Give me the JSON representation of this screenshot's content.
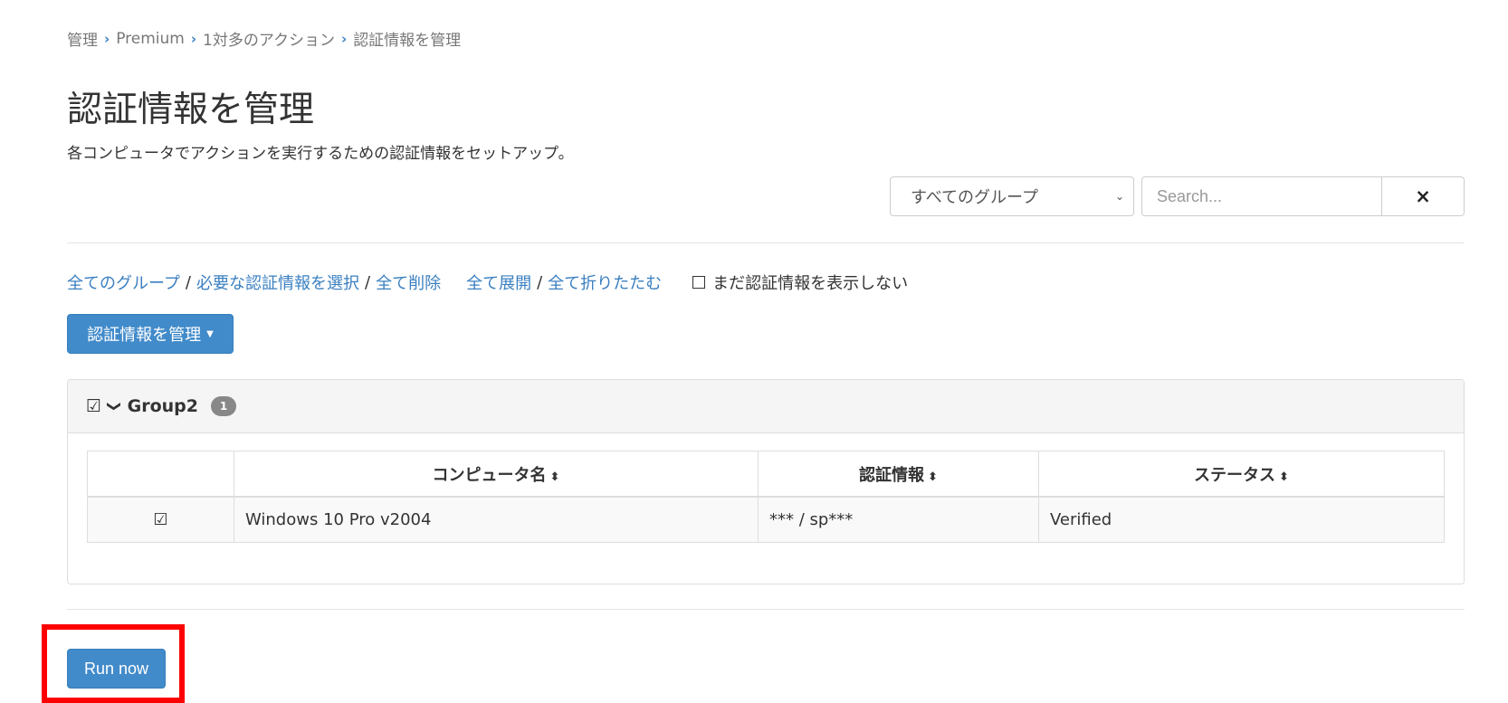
{
  "breadcrumb": {
    "items": [
      "管理",
      "Premium",
      "1対多のアクション",
      "認証情報を管理"
    ]
  },
  "page": {
    "title": "認証情報を管理",
    "subtitle": "各コンピュータでアクションを実行するための認証情報をセットアップ。"
  },
  "filter": {
    "group_select": "すべてのグループ",
    "search_placeholder": "Search...",
    "clear_icon": "×"
  },
  "links": {
    "all_groups": "全てのグループ",
    "select_required": "必要な認証情報を選択",
    "delete_all": "全て削除",
    "expand_all": "全て展開",
    "collapse_all": "全て折りたたむ",
    "hide_checkbox_label": "まだ認証情報を表示しない"
  },
  "manage_button": {
    "label": "認証情報を管理"
  },
  "group": {
    "name": "Group2",
    "count": "1",
    "checkbox": "☑",
    "chevron": "❯"
  },
  "table": {
    "headers": [
      "コンピュータ名",
      "認証情報",
      "ステータス"
    ],
    "sort_icon": "⬍",
    "rows": [
      {
        "checked": "☑",
        "computer": "Windows 10 Pro v2004",
        "credential": "*** / sp***",
        "status": "Verified"
      }
    ]
  },
  "run_button": {
    "label": "Run now"
  },
  "colors": {
    "accent": "#428bca",
    "link": "#3a7fc0",
    "highlight": "#ff0000"
  }
}
